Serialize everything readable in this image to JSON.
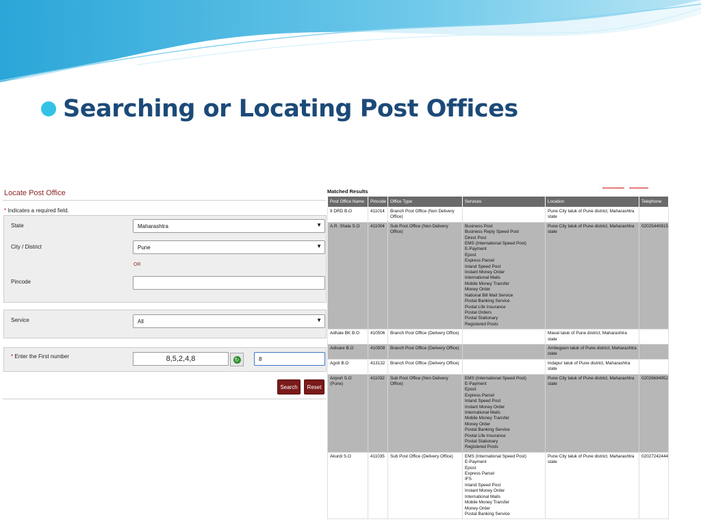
{
  "slide": {
    "title": "Searching or Locating Post Offices"
  },
  "form": {
    "title": "Locate Post Office",
    "required_note": "Indicates a required field.",
    "required_star": "*",
    "state_label": "State",
    "state_value": "Maharashtra",
    "city_label": "City / District",
    "city_value": "Pune",
    "or_label": "OR",
    "pincode_label": "Pincode",
    "pincode_value": "",
    "service_label": "Service",
    "service_value": "All",
    "first_number_label": "Enter the First number",
    "captcha_text": "8,5,2,4,8",
    "answer_value": "8",
    "search_label": "Search",
    "reset_label": "Reset",
    "dropdown_arrow": "▼"
  },
  "results": {
    "title": "Matched Results",
    "columns": [
      "Post Office Name",
      "Pincode",
      "Office Type",
      "Services",
      "Location",
      "Telephone"
    ],
    "rows": [
      {
        "name": "9 DRD B.O",
        "pincode": "411014",
        "type": "Branch Post Office (Non Delivery Office)",
        "services": [],
        "location": "Pune City taluk of Pune district, Maharashtra state",
        "telephone": ""
      },
      {
        "name": "A.R. Shala S.O",
        "pincode": "411004",
        "type": "Sub Post Office (Non Delivery Office)",
        "services": [
          "Business Post",
          "Business Reply Speed Post",
          "Direct Post",
          "EMS (International Speed Post)",
          "E-Payment",
          "Epost",
          "Express Parcel",
          "Inland Speed Post",
          "Instant Money Order",
          "International Mails",
          "Mobile Money Transfer",
          "Money Order",
          "National Bill Mail Service",
          "Postal Banking Service",
          "Postal Life Insurance",
          "Postal Orders",
          "Postal Stationary",
          "Registered Posts"
        ],
        "location": "Pune City taluk of Pune district, Maharashtra state",
        "telephone": "02025440815"
      },
      {
        "name": "Adhale BK B.O",
        "pincode": "410506",
        "type": "Branch Post Office (Delivery Office)",
        "services": [],
        "location": "Maval taluk of Pune district, Maharashtra state",
        "telephone": ""
      },
      {
        "name": "Adivare B.O",
        "pincode": "410509",
        "type": "Branch Post Office (Delivery Office)",
        "services": [],
        "location": "Ambegaon taluk of Pune district, Maharashtra state",
        "telephone": ""
      },
      {
        "name": "Agoti B.O",
        "pincode": "413132",
        "type": "Branch Post Office (Delivery Office)",
        "services": [],
        "location": "Indapur taluk of Pune district, Maharashtra state",
        "telephone": ""
      },
      {
        "name": "Airport S.O (Pune)",
        "pincode": "411032",
        "type": "Sub Post Office (Non Delivery Office)",
        "services": [
          "EMS (International Speed Post)",
          "E-Payment",
          "Epost",
          "Express Parcel",
          "Inland Speed Post",
          "Instant Money Order",
          "International Mails",
          "Mobile Money Transfer",
          "Money Order",
          "Postal Banking Service",
          "Postal Life Insurance",
          "Postal Stationary",
          "Registered Posts"
        ],
        "location": "Pune City taluk of Pune district, Maharashtra state",
        "telephone": "02026684952"
      },
      {
        "name": "Akurdi S.O",
        "pincode": "411035",
        "type": "Sub Post Office (Delivery Office)",
        "services": [
          "EMS (International Speed Post)",
          "E-Payment",
          "Epost",
          "Express Parcel",
          "IFS",
          "Inland Speed Post",
          "Instant Money Order",
          "International Mails",
          "Mobile Money Transfer",
          "Money Order",
          "Postal Banking Service"
        ],
        "location": "Pune City taluk of Pune district, Maharashtra state",
        "telephone": "02027242444"
      }
    ]
  }
}
